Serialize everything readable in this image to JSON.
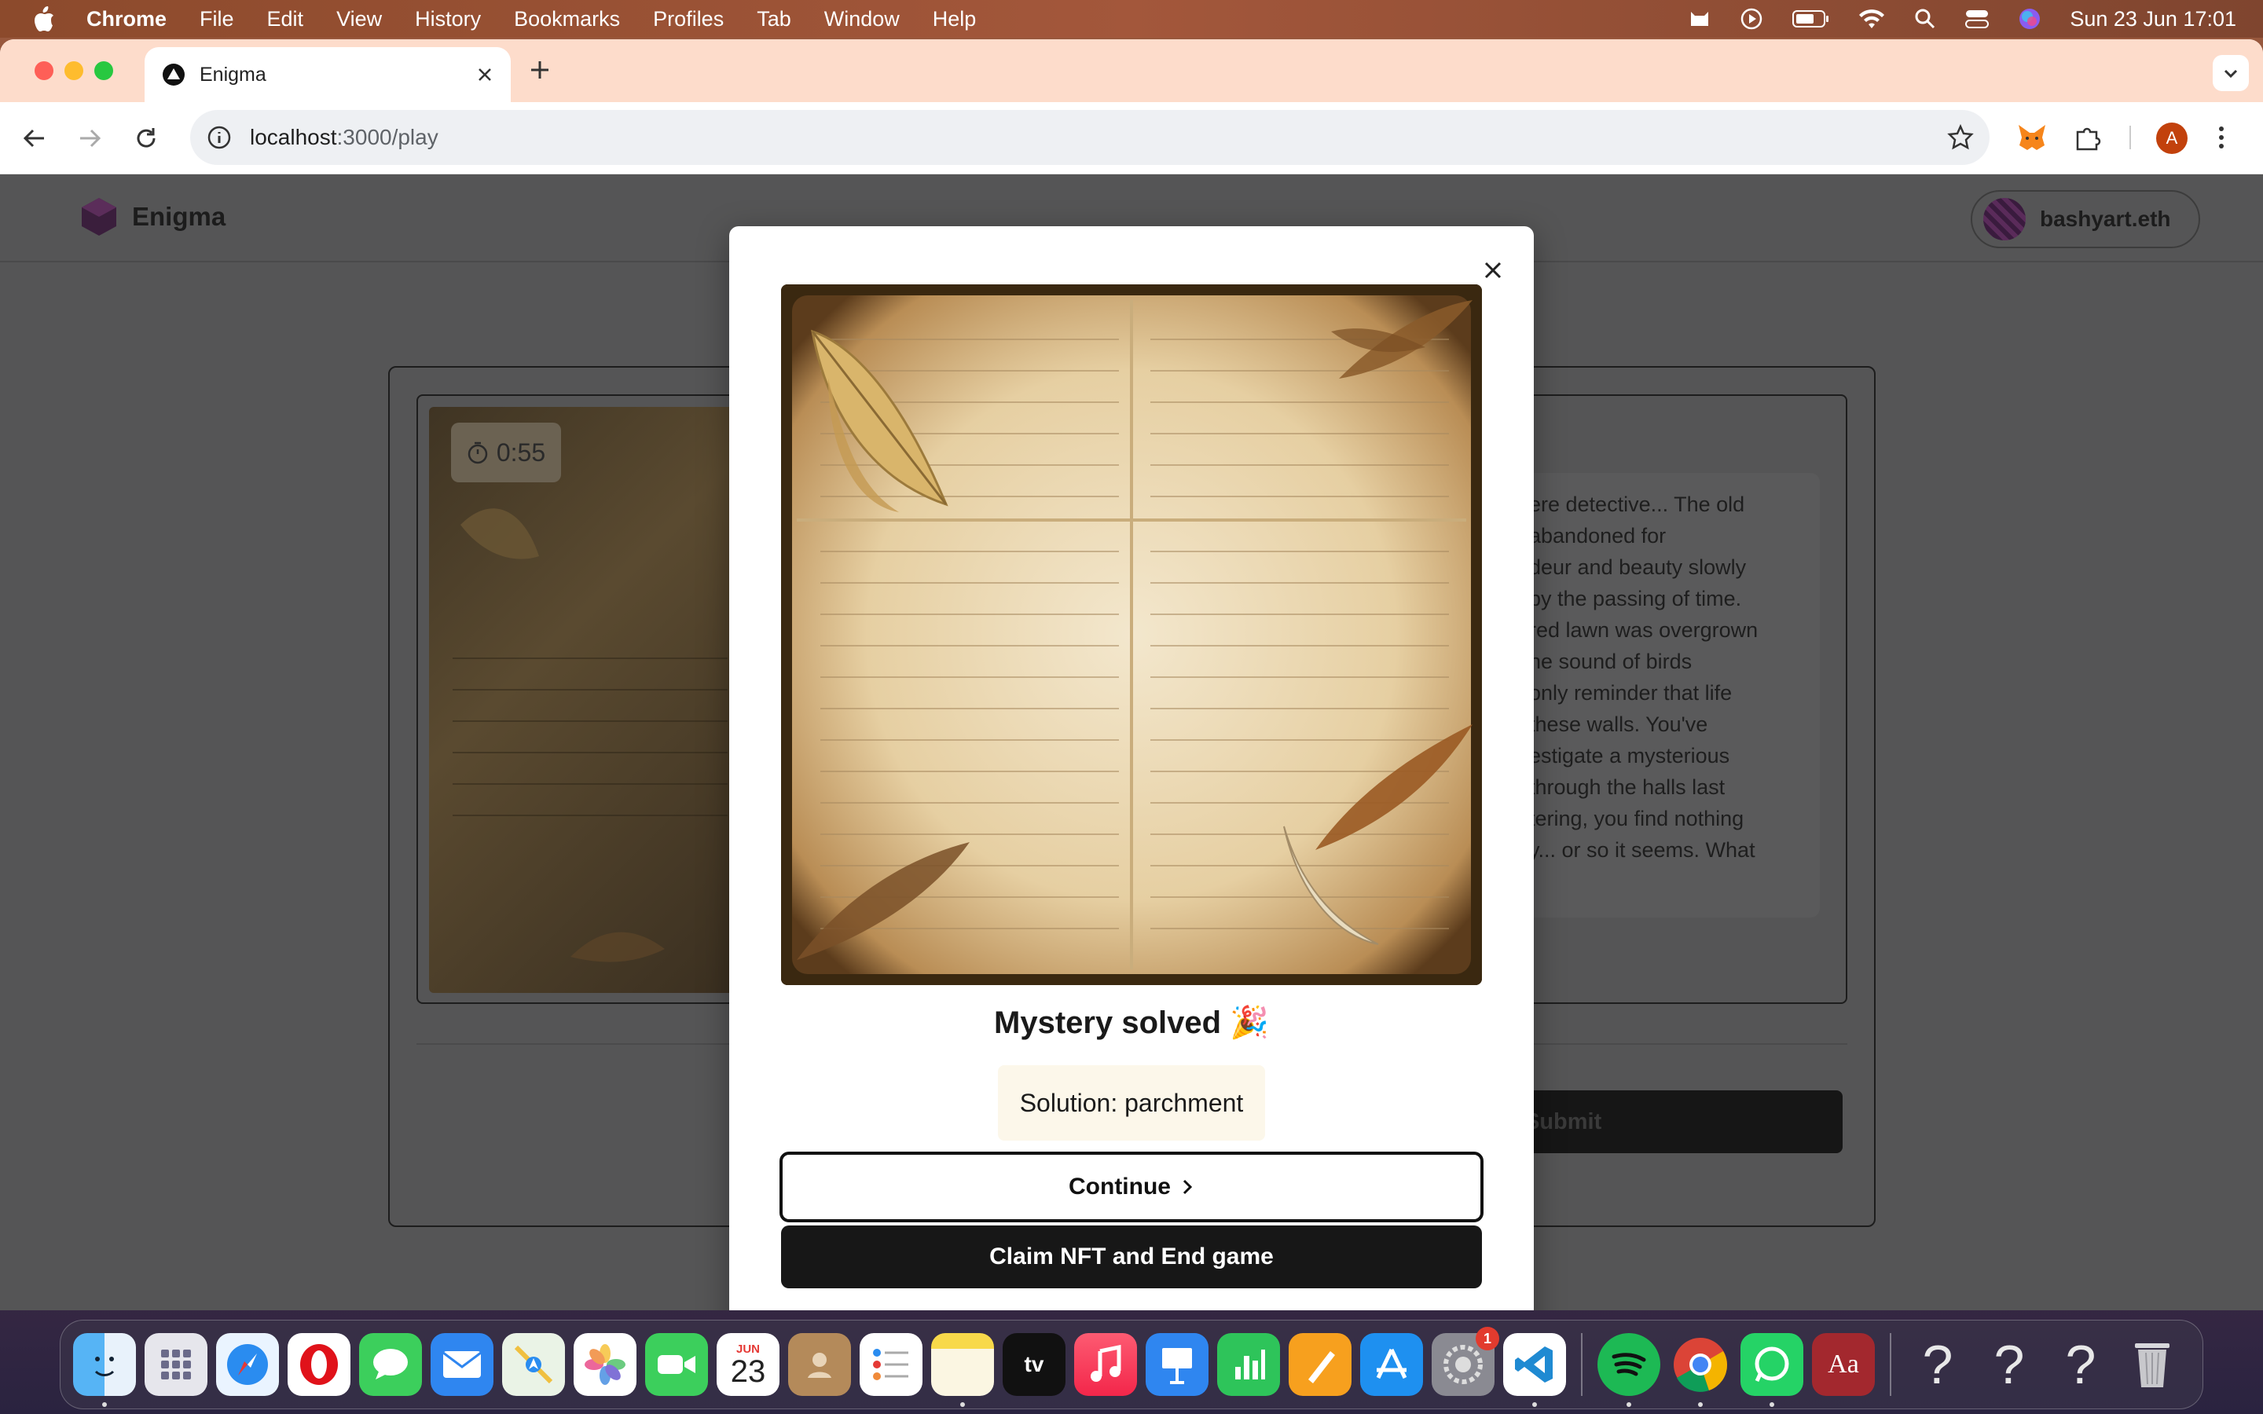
{
  "menubar": {
    "app_name": "Chrome",
    "items": [
      "File",
      "Edit",
      "View",
      "History",
      "Bookmarks",
      "Profiles",
      "Tab",
      "Window",
      "Help"
    ],
    "datetime": "Sun 23 Jun  17:01"
  },
  "browser": {
    "tab_title": "Enigma",
    "url_host": "localhost",
    "url_path": ":3000/play",
    "profile_initial": "A"
  },
  "app": {
    "brand": "Enigma",
    "account": "bashyart.eth",
    "timer": "0:55",
    "story_text": "ere detective... The old\n abandoned for\ndeur and beauty slowly\nby the passing of time.\nred lawn was overgrown\nhe sound of birds\nonly reminder that life\n these walls. You've\nestigate a mysterious\n through the halls last\ntering, you find nothing\ny... or so it seems. What",
    "submit_label": "Submit"
  },
  "modal": {
    "title": "Mystery solved 🎉",
    "solution": "Solution: parchment",
    "continue_label": "Continue",
    "claim_label": "Claim NFT and End game"
  },
  "dock": {
    "calendar_month": "JUN",
    "calendar_day": "23",
    "settings_badge": "1",
    "dictionary_label": "Aa",
    "unknown_label": "?"
  },
  "colors": {
    "accent": "#171717",
    "solution_bg": "#fcf7ea",
    "tabbar": "#fddccb"
  }
}
